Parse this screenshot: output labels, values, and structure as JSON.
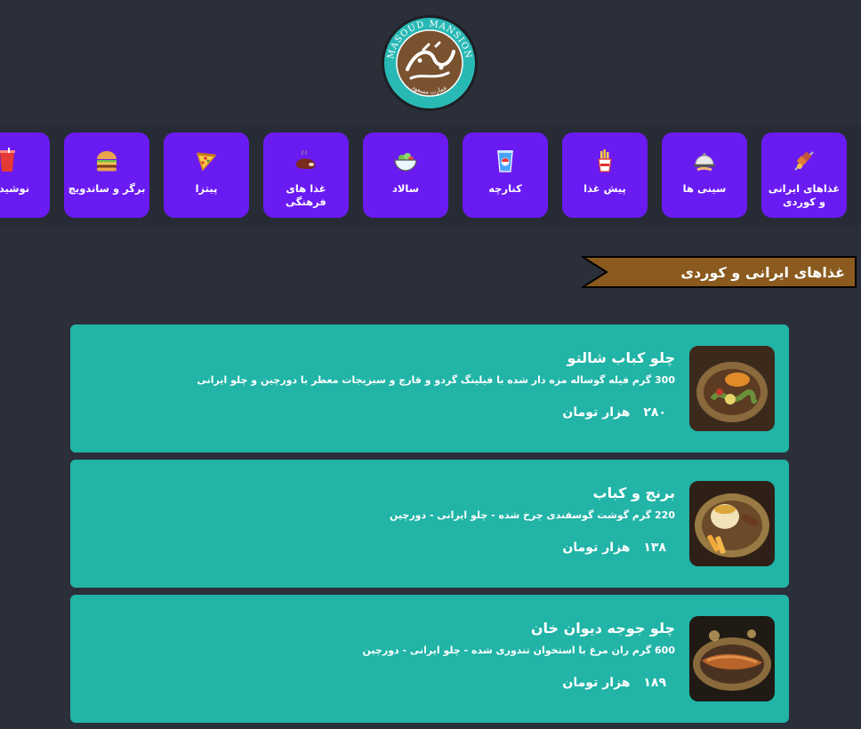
{
  "logo": {
    "alt_text": "عمارت مسعود",
    "ring_text": "MASOUD MANSION",
    "sub_text": "عمارت مسعود"
  },
  "categories": [
    {
      "label": "غذاهای ایرانی و کوردی",
      "icon": "kebab-skewer-icon"
    },
    {
      "label": "سینی ها",
      "icon": "serving-tray-icon"
    },
    {
      "label": "پیش غذا",
      "icon": "french-fries-icon"
    },
    {
      "label": "کنارچه",
      "icon": "soda-cup-icon"
    },
    {
      "label": "سالاد",
      "icon": "salad-bowl-icon"
    },
    {
      "label": "غذا های فرهنگی",
      "icon": "steak-icon"
    },
    {
      "label": "پیتزا",
      "icon": "pizza-slice-icon"
    },
    {
      "label": "برگر و ساندویچ",
      "icon": "burger-icon"
    },
    {
      "label": "نوشیدنی",
      "icon": "drink-cup-icon"
    }
  ],
  "section": {
    "title": "غذاهای ایرانی و کوردی"
  },
  "items": [
    {
      "name": "چلو کباب شالتو",
      "description": "300 گرم فیله گوساله مزه دار شده با فیلینگ گردو و قارچ و سبزیجات معطر با دورچین و چلو ایرانی",
      "price": "۲۸۰",
      "currency": "هزار تومان"
    },
    {
      "name": "برنج و کباب",
      "description": "220 گرم گوشت گوسفندی چرخ شده - چلو ایرانی - دورچین",
      "price": "۱۳۸",
      "currency": "هزار تومان"
    },
    {
      "name": "چلو جوجه دیوان خان",
      "description": "600 گرم ران مرغ با استخوان تندوری شده - چلو ایرانی - دورچین",
      "price": "۱۸۹",
      "currency": "هزار تومان"
    }
  ],
  "colors": {
    "background": "#2b2f3a",
    "category_bg": "#6a1bf2",
    "card_bg": "#21b4a7",
    "ribbon_bg": "#8a5a1e",
    "logo_teal": "#29b9b5",
    "logo_brown": "#7a5230"
  }
}
